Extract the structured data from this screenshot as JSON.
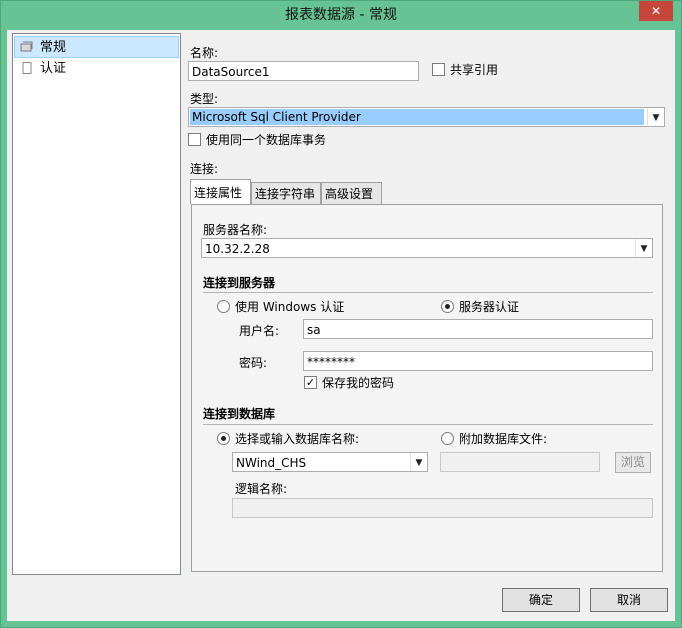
{
  "window": {
    "title": "报表数据源 - 常规",
    "close_glyph": "✕"
  },
  "nav": {
    "items": [
      {
        "label": "常规",
        "icon": "general-icon",
        "selected": true
      },
      {
        "label": "认证",
        "icon": "page-icon",
        "selected": false
      }
    ]
  },
  "general": {
    "name_label": "名称:",
    "name_value": "DataSource1",
    "shared_label": "共享引用",
    "shared_checked": false,
    "type_label": "类型:",
    "type_value": "Microsoft Sql Client Provider",
    "single_transaction_label": "使用同一个数据库事务",
    "single_transaction_checked": false,
    "connection_label": "连接:"
  },
  "tabs": [
    {
      "label": "连接属性",
      "active": true
    },
    {
      "label": "连接字符串",
      "active": false
    },
    {
      "label": "高级设置",
      "active": false
    }
  ],
  "connection": {
    "server_name_label": "服务器名称:",
    "server_name_value": "10.32.2.28",
    "connect_server_header": "连接到服务器",
    "auth_windows_label": "使用 Windows 认证",
    "auth_server_label": "服务器认证",
    "auth_selected": "server",
    "username_label": "用户名:",
    "username_value": "sa",
    "password_label": "密码:",
    "password_value": "********",
    "save_password_label": "保存我的密码",
    "save_password_checked": true,
    "connect_db_header": "连接到数据库",
    "select_db_label": "选择或输入数据库名称:",
    "attach_db_label": "附加数据库文件:",
    "db_selected": "select",
    "db_name_value": "NWind_CHS",
    "browse_label": "浏览",
    "logical_name_label": "逻辑名称:"
  },
  "buttons": {
    "ok": "确定",
    "cancel": "取消"
  },
  "check_glyph": "✓",
  "combo_arrow_glyph": "▼",
  "colors": {
    "title_bar": "#66c393",
    "selection": "#cce8ff",
    "type_highlight": "#99ccff"
  }
}
